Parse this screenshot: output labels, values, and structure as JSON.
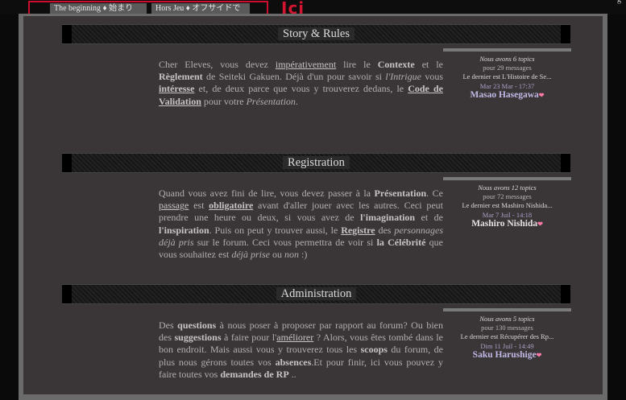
{
  "tabs": [
    {
      "label": "The beginning ♦ 始まり"
    },
    {
      "label": "Hors Jeu ♦ オフサイドで"
    }
  ],
  "annotation": {
    "label": "Ici"
  },
  "corner_text": "g",
  "sections": [
    {
      "title": "Story & Rules",
      "desc": {
        "a": "Cher Eleves, vous devez ",
        "b": "impérativement",
        "c": " lire le ",
        "d": "Contexte",
        "e": " et le ",
        "f": "Règlement",
        "g": " de Seiteki Gakuen. Déjà d'un pour savoir si ",
        "h": "l'Intrigue",
        "i": " vous ",
        "j": "intéresse",
        "k": " et, de deux parce que vous y trouverez dedans, le ",
        "l": "Code de Validation",
        "m": " pour votre ",
        "n": "Présentation",
        "o": "."
      },
      "stats": {
        "topics": "Nous avons 6 topics",
        "messages": "pour 29 messages",
        "last": "Le dernier est L'Histoire de Se...",
        "date": "Mar 23 Mar - 17:37",
        "user": "Masao Hasegawa"
      }
    },
    {
      "title": "Registration",
      "desc": {
        "a": "Quand vous avez fini de lire, vous devez passer à la ",
        "b": "Présentation",
        "c": ". Ce ",
        "d": "passage",
        "e": " est ",
        "f": "obligatoire",
        "g": " avant d'aller jouer avec les autres. Ceci peut prendre une heure ou deux, si vous avez de ",
        "h": "l'imagination",
        "i": " et de ",
        "j": "l'inspiration",
        "k": ". Puis on peut y trouver aussi, le ",
        "l": "Registre",
        "m": " des ",
        "n": "personnages déjà pris",
        "o": " sur le forum. Ceci vous permettra de voir si ",
        "p": "la Célébrité",
        "q": " que vous souhaitez est ",
        "r": "déjà prise",
        "s": " ou ",
        "t": "non",
        "u": " :)"
      },
      "stats": {
        "topics": "Nous avons 12 topics",
        "messages": "pour 72 messages",
        "last": "Le dernier est Mashiro Nishida...",
        "date": "Mar 7 Juil - 14:18",
        "user": "Mashiro Nishida"
      }
    },
    {
      "title": "Administration",
      "desc": {
        "a": "Des ",
        "b": "questions",
        "c": " à nous poser à proposer par rapport au forum? Ou bien des ",
        "d": "suggestions",
        "e": " à faire pour l'",
        "f": "améliorer",
        "g": " ? Alors, vous êtes tombé dans le bon endroit. Mais aussi vous y trouverez tous les ",
        "h": "scoops",
        "i": " du forum, de plus nous gérons toutes vos ",
        "j": "absences",
        "k": ".Et pour finir, ici vous pouvez y faire toutes vos ",
        "l": "demandes de RP",
        "m": " .."
      },
      "stats": {
        "topics": "Nous avons 5 topics",
        "messages": "pour 130 messages",
        "last": "Le dernier est Récupérer des Rp...",
        "date": "Dim 11 Juil - 14:49",
        "user": "Saku Harushige"
      }
    }
  ],
  "colors": {
    "accent_red": "#d1142f",
    "username_purple": "#c0b9e6",
    "heart_pink": "#ff7aa8"
  }
}
